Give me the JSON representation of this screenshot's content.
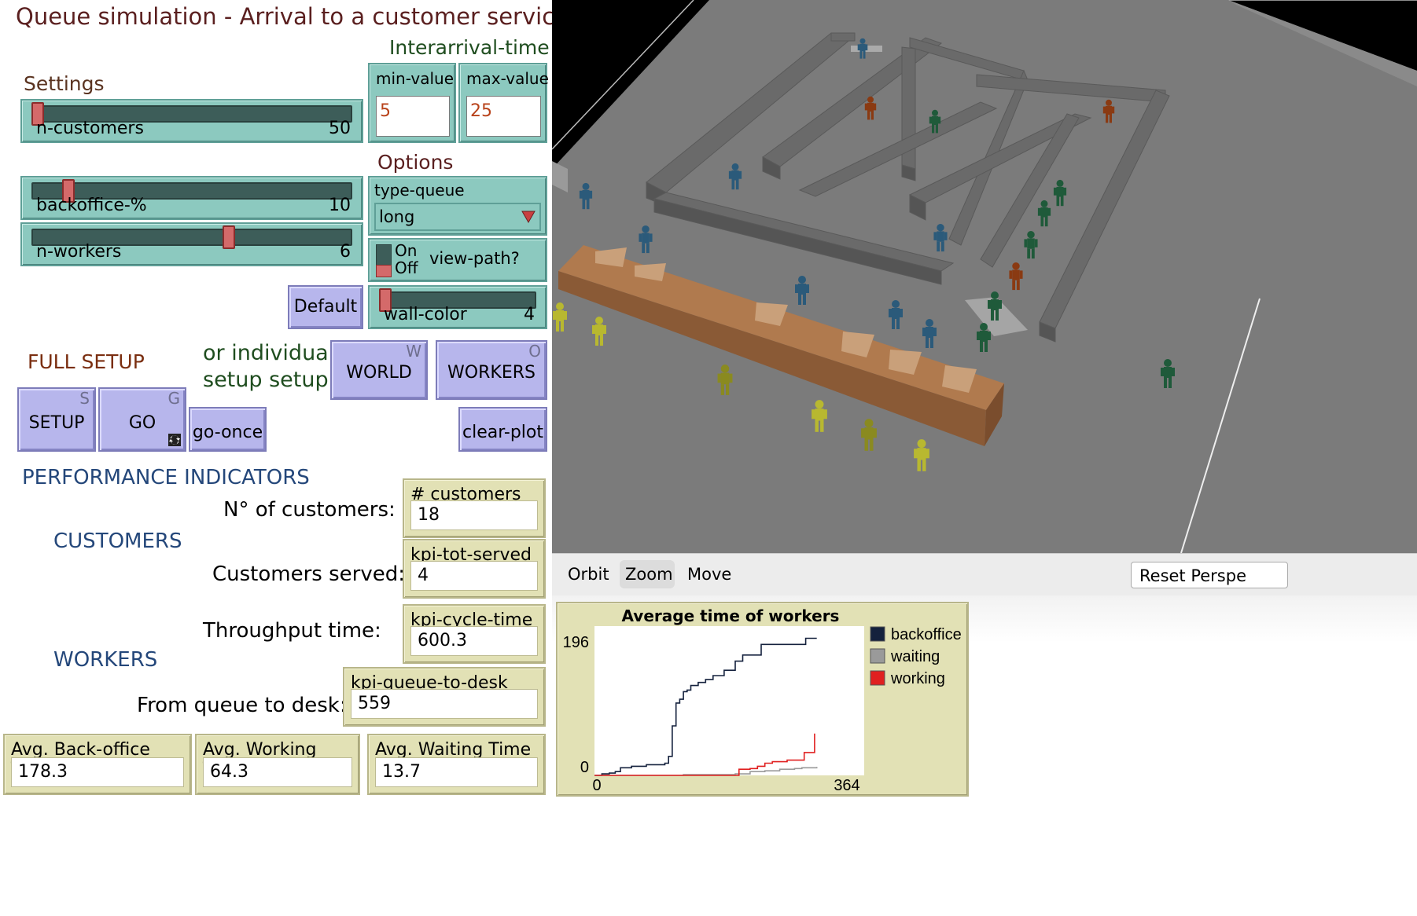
{
  "title": "Queue simulation - Arrival to a customer service",
  "settings": {
    "heading": "Settings",
    "n_customers": {
      "label": "n-customers",
      "value": "50",
      "fraction": 0.0
    },
    "backoffice": {
      "label": "backoffice-%",
      "value": "10",
      "fraction": 0.1
    },
    "n_workers": {
      "label": "n-workers",
      "value": "6",
      "fraction": 0.62
    },
    "default_label": "Default"
  },
  "interarrival": {
    "heading": "Interarrival-time",
    "min_label": "min-value",
    "min_value": "5",
    "max_label": "max-value",
    "max_value": "25"
  },
  "options": {
    "heading": "Options",
    "type_queue_label": "type-queue",
    "type_queue_value": "long",
    "switch_on": "On",
    "switch_off": "Off",
    "view_path_label": "view-path?",
    "wall_color": {
      "label": "wall-color",
      "value": "4",
      "fraction": 0.0
    }
  },
  "setup": {
    "full_setup": "FULL SETUP",
    "individual_line1": "or individual",
    "individual_line2": "setup setup",
    "setup_label": "SETUP",
    "setup_key": "S",
    "go_label": "GO",
    "go_key": "G",
    "go_once_label": "go-once",
    "world_label": "WORLD",
    "world_key": "W",
    "workers_label": "WORKERS",
    "workers_key": "O",
    "clear_plot_label": "clear-plot"
  },
  "kpi": {
    "heading": "PERFORMANCE INDICATORS",
    "customers_heading": "CUSTOMERS",
    "workers_heading": "WORKERS",
    "n_customers_text": "N° of customers:",
    "served_text": "Customers served:",
    "throughput_text": "Throughput time:",
    "queue_desk_text": "From queue to desk:",
    "monitors": {
      "customers": {
        "label": "# customers",
        "value": "18"
      },
      "served": {
        "label": "kpi-tot-served",
        "value": "4"
      },
      "cycle": {
        "label": "kpi-cycle-time",
        "value": "600.3"
      },
      "queue_desk": {
        "label": "kpi-queue-to-desk",
        "value": "559"
      },
      "backoffice": {
        "label": "Avg. Back-office Time",
        "value": "178.3"
      },
      "working": {
        "label": "Avg. Working Time",
        "value": "64.3"
      },
      "waiting": {
        "label": "Avg. Waiting Time",
        "value": "13.7"
      }
    }
  },
  "view_toolbar": {
    "orbit": "Orbit",
    "zoom": "Zoom",
    "move": "Move",
    "reset": "Reset Perspe"
  },
  "colors": {
    "floor": "#7a7a7a",
    "walls": "#5e5e5e",
    "desk": "#b07a4e",
    "backoffice_series": "#14213d",
    "waiting_series": "#9a9a9a",
    "working_series": "#e02020"
  },
  "chart_data": {
    "type": "line",
    "title": "Average time of workers",
    "xlim": [
      0,
      364
    ],
    "ylim": [
      0,
      196
    ],
    "x_ticks": [
      "0",
      "364"
    ],
    "y_ticks": [
      "196",
      "0"
    ],
    "legend_position": "right",
    "series": [
      {
        "name": "backoffice",
        "color": "#14213d",
        "points": [
          [
            0,
            0
          ],
          [
            10,
            2
          ],
          [
            20,
            3
          ],
          [
            28,
            5
          ],
          [
            35,
            10
          ],
          [
            50,
            12
          ],
          [
            70,
            14
          ],
          [
            95,
            16
          ],
          [
            100,
            25
          ],
          [
            105,
            65
          ],
          [
            110,
            95
          ],
          [
            115,
            100
          ],
          [
            120,
            110
          ],
          [
            125,
            112
          ],
          [
            130,
            118
          ],
          [
            140,
            122
          ],
          [
            150,
            126
          ],
          [
            160,
            131
          ],
          [
            175,
            138
          ],
          [
            190,
            150
          ],
          [
            200,
            158
          ],
          [
            225,
            172
          ],
          [
            240,
            172
          ],
          [
            260,
            172
          ],
          [
            280,
            172
          ],
          [
            285,
            180
          ],
          [
            285,
            180
          ],
          [
            300,
            180
          ]
        ]
      },
      {
        "name": "waiting",
        "color": "#9a9a9a",
        "points": [
          [
            0,
            0
          ],
          [
            100,
            0
          ],
          [
            120,
            1
          ],
          [
            160,
            1
          ],
          [
            190,
            2
          ],
          [
            210,
            5
          ],
          [
            230,
            6
          ],
          [
            250,
            8
          ],
          [
            270,
            9
          ],
          [
            280,
            10
          ],
          [
            300,
            11
          ]
        ]
      },
      {
        "name": "working",
        "color": "#e02020",
        "points": [
          [
            0,
            0
          ],
          [
            190,
            0
          ],
          [
            195,
            8
          ],
          [
            210,
            9
          ],
          [
            220,
            12
          ],
          [
            230,
            16
          ],
          [
            240,
            18
          ],
          [
            260,
            20
          ],
          [
            280,
            20
          ],
          [
            283,
            30
          ],
          [
            295,
            30
          ],
          [
            297,
            55
          ]
        ]
      }
    ]
  }
}
